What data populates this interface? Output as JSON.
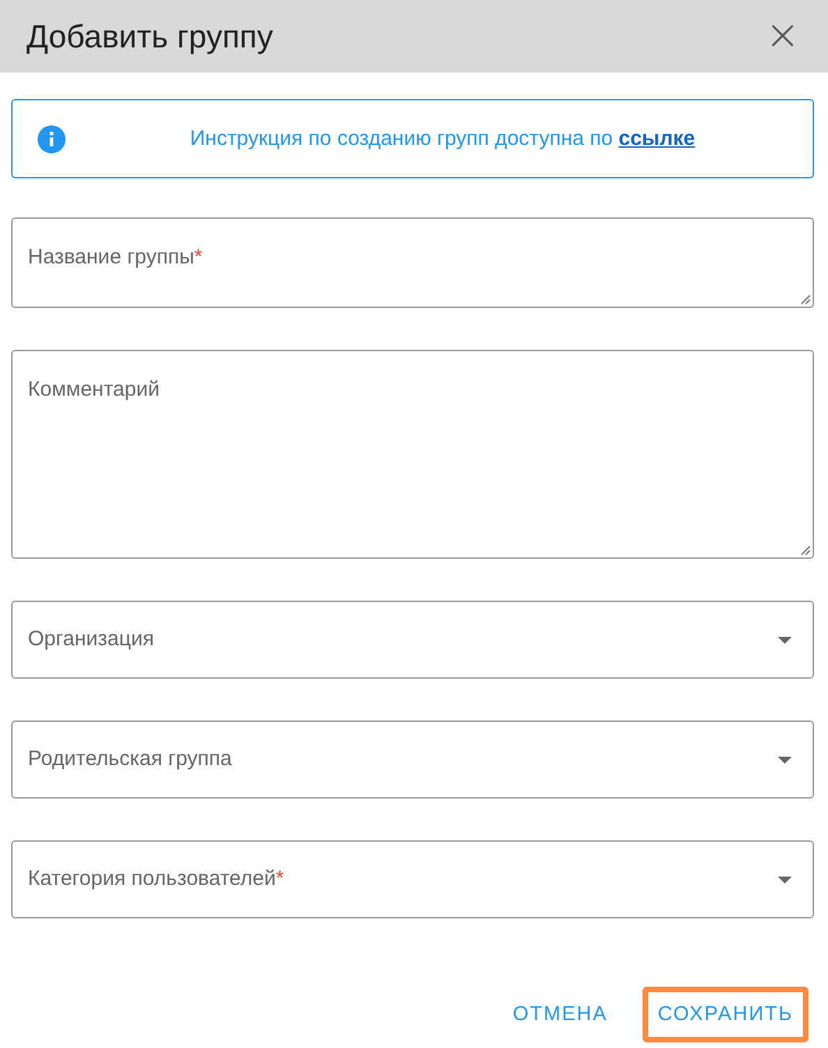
{
  "dialog": {
    "title": "Добавить группу",
    "close": "×"
  },
  "info": {
    "text": "Инструкция по созданию групп доступна по ",
    "link": "ссылке"
  },
  "fields": [
    {
      "kind": "short_text",
      "placeholder": "Название группы",
      "required_mark": "*"
    },
    {
      "kind": "long_text",
      "placeholder": "Комментарий"
    },
    {
      "kind": "select",
      "placeholder": "Организация"
    },
    {
      "kind": "select",
      "placeholder": "Родительская группа"
    },
    {
      "kind": "select",
      "placeholder": "Категория пользователей",
      "required_mark": "*"
    }
  ],
  "buttons": [
    {
      "label": "ОТМЕНА",
      "highlighted": false
    },
    {
      "label": "СОХРАНИТЬ",
      "highlighted": true
    }
  ]
}
